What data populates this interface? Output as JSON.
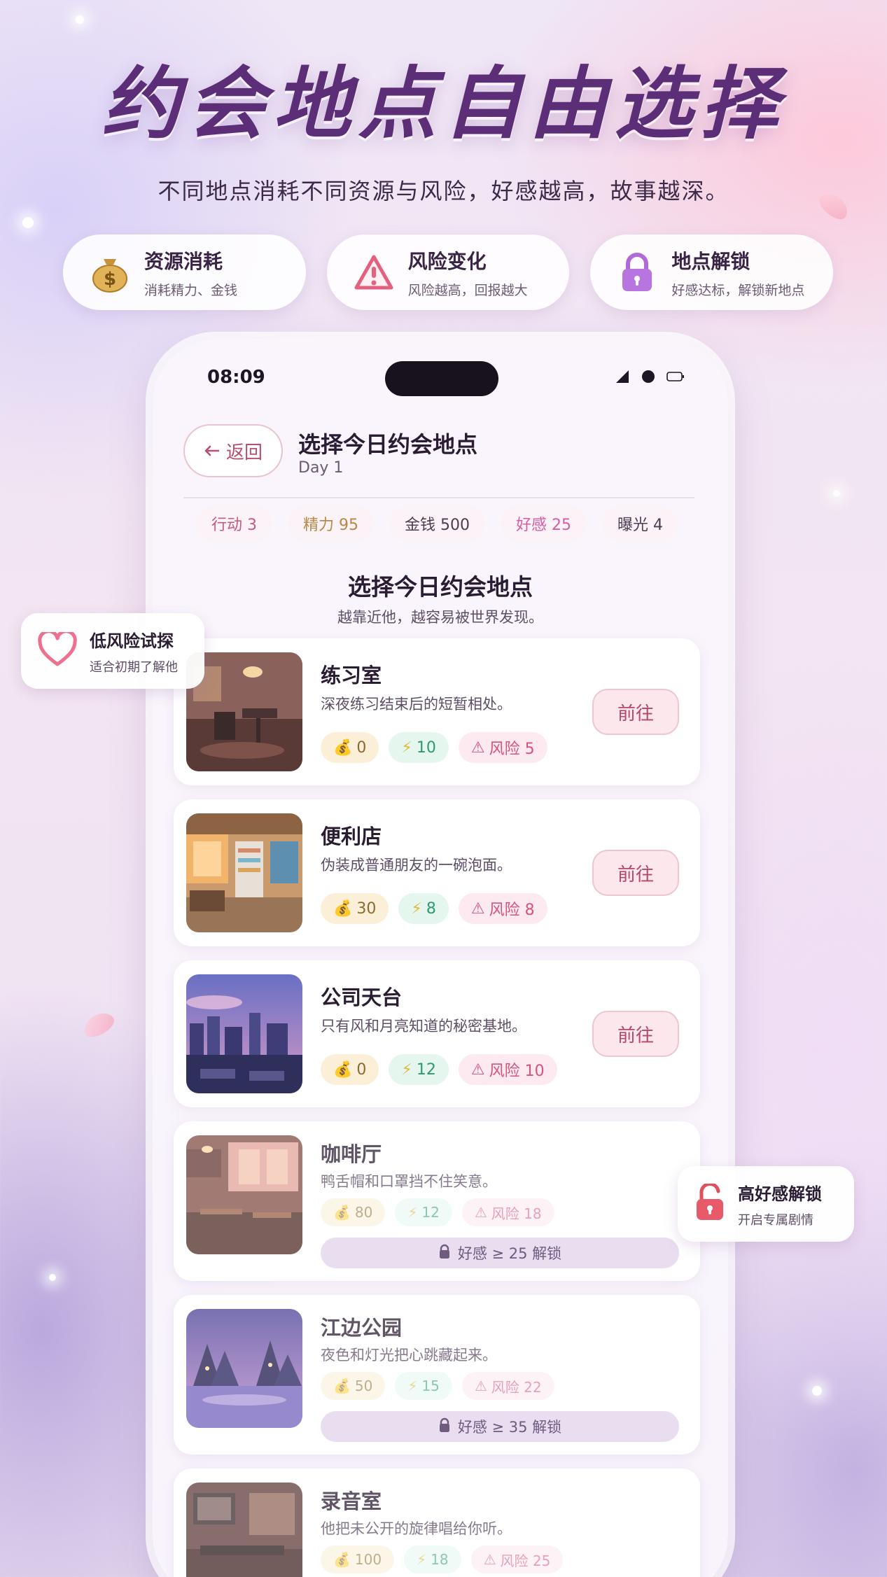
{
  "hero": {
    "title": "约会地点自由选择",
    "subtitle": "不同地点消耗不同资源与风险，好感越高，故事越深。"
  },
  "features": [
    {
      "icon": "money-bag-icon",
      "title": "资源消耗",
      "desc": "消耗精力、金钱"
    },
    {
      "icon": "warning-icon",
      "title": "风险变化",
      "desc": "风险越高，回报越大"
    },
    {
      "icon": "lock-icon",
      "title": "地点解锁",
      "desc": "好感达标，解锁新地点"
    }
  ],
  "status_bar": {
    "time": "08:09"
  },
  "header": {
    "back_label": "返回",
    "title": "选择今日约会地点",
    "day": "Day 1"
  },
  "stats": [
    {
      "label": "行动 3",
      "color": "#c9597a"
    },
    {
      "label": "精力 95",
      "color": "#b88845"
    },
    {
      "label": "金钱 500",
      "color": "#4a3f52"
    },
    {
      "label": "好感 25",
      "color": "#d65ea4"
    },
    {
      "label": "曝光 4",
      "color": "#4a3f52"
    }
  ],
  "section": {
    "title": "选择今日约会地点",
    "subtitle": "越靠近他，越容易被世界发现。"
  },
  "locations": [
    {
      "name": "练习室",
      "desc": "深夜练习结束后的短暂相处。",
      "money": "0",
      "energy": "10",
      "risk": "风险 5",
      "action": "前往",
      "locked": false
    },
    {
      "name": "便利店",
      "desc": "伪装成普通朋友的一碗泡面。",
      "money": "30",
      "energy": "8",
      "risk": "风险 8",
      "action": "前往",
      "locked": false
    },
    {
      "name": "公司天台",
      "desc": "只有风和月亮知道的秘密基地。",
      "money": "0",
      "energy": "12",
      "risk": "风险 10",
      "action": "前往",
      "locked": false
    },
    {
      "name": "咖啡厅",
      "desc": "鸭舌帽和口罩挡不住笑意。",
      "money": "80",
      "energy": "12",
      "risk": "风险 18",
      "lock_text": "好感 ≥ 25 解锁",
      "locked": true
    },
    {
      "name": "江边公园",
      "desc": "夜色和灯光把心跳藏起来。",
      "money": "50",
      "energy": "15",
      "risk": "风险 22",
      "lock_text": "好感 ≥ 35 解锁",
      "locked": true
    },
    {
      "name": "录音室",
      "desc": "他把未公开的旋律唱给你听。",
      "money": "100",
      "energy": "18",
      "risk": "风险 25",
      "locked": true
    }
  ],
  "float_tags": {
    "low_risk": {
      "title": "低风险试探",
      "desc": "适合初期了解他"
    },
    "unlock": {
      "title": "高好感解锁",
      "desc": "开启专属剧情"
    }
  },
  "colors": {
    "accent": "#b4476a",
    "title": "#5d2e78",
    "lock": "#b06ad8"
  }
}
